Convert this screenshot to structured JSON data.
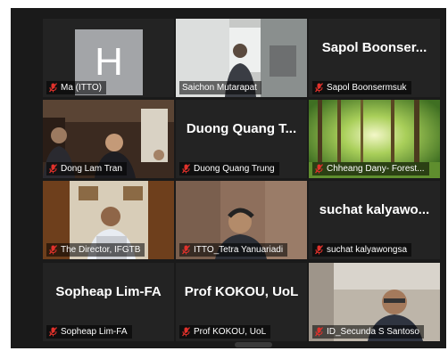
{
  "tiles": [
    {
      "name": "Ma (ITTO)",
      "avatar_letter": "H",
      "kind": "avatar"
    },
    {
      "name": "Saichon Mutarapat",
      "kind": "video",
      "active": true
    },
    {
      "name": "Sapol Boonsermsuk",
      "display": "Sapol  Boonser...",
      "kind": "name"
    },
    {
      "name": "Dong Lam Tran",
      "kind": "video"
    },
    {
      "name": "Duong Quang Trung",
      "display": "Duong Quang T...",
      "kind": "name"
    },
    {
      "name": "Chheang Dany- Forest...",
      "kind": "video"
    },
    {
      "name": "The Director, IFGTB",
      "kind": "video"
    },
    {
      "name": "ITTO_Tetra Yanuariadi",
      "kind": "video"
    },
    {
      "name": "suchat kalyawongsa",
      "display": "suchat  kalyawo...",
      "kind": "name"
    },
    {
      "name": "Sopheap Lim-FA",
      "display": "Sopheap Lim-FA",
      "kind": "name"
    },
    {
      "name": "Prof KOKOU, UoL",
      "display": "Prof KOKOU, UoL",
      "kind": "name"
    },
    {
      "name": "ID_Secunda S Santoso",
      "kind": "video"
    }
  ],
  "colors": {
    "mic_muted": "#e0312b",
    "active_border": "#e3e85f",
    "tile_bg": "#232323"
  },
  "icons": {
    "mic": "microphone-muted-icon"
  }
}
